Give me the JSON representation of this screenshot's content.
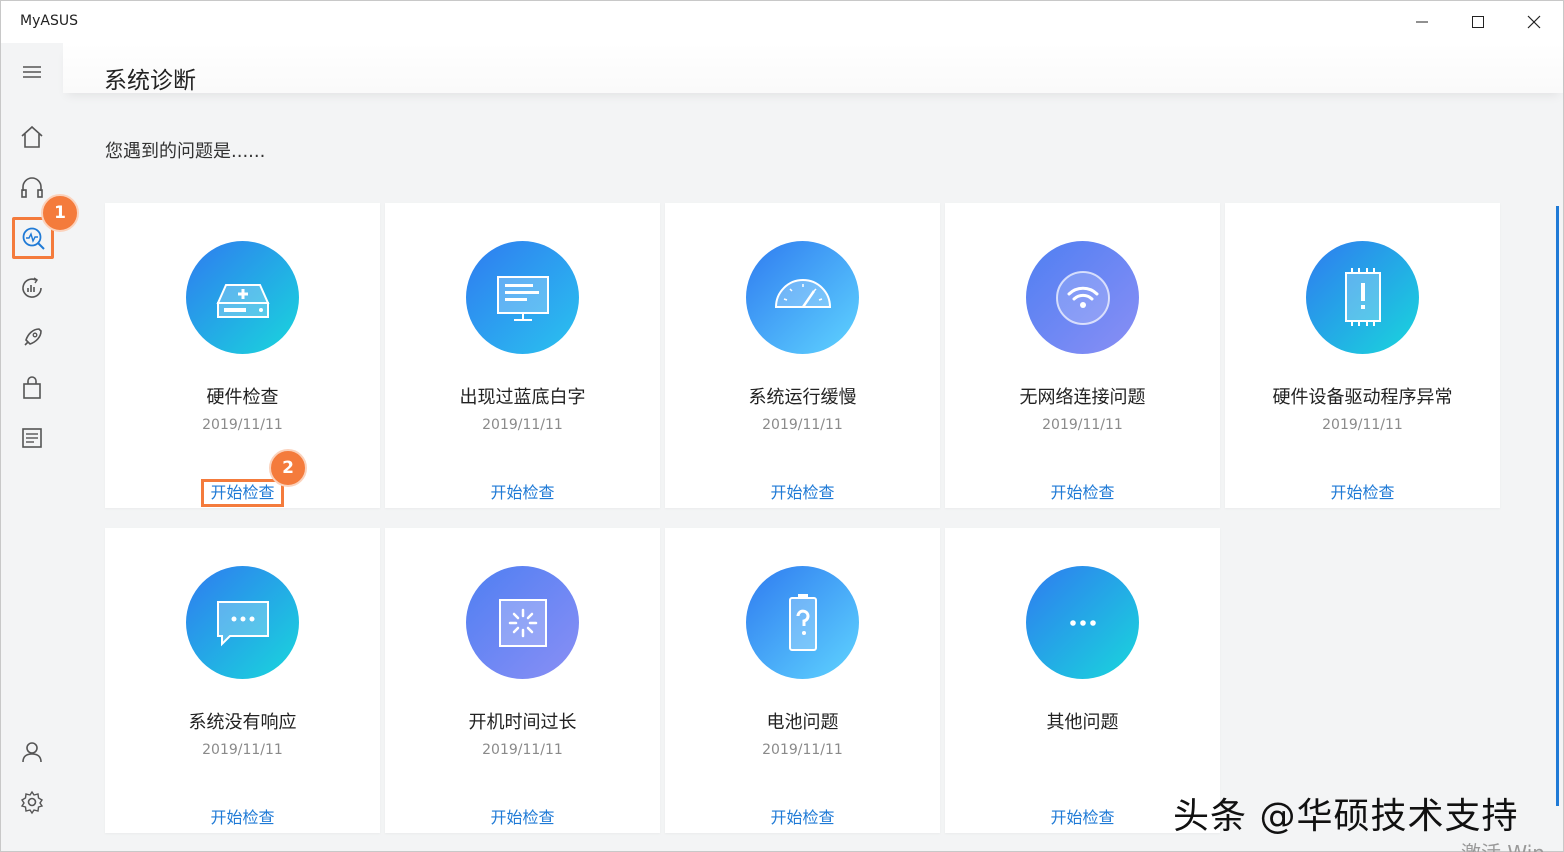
{
  "app": {
    "title": "MyASUS"
  },
  "header": {
    "title": "系统诊断"
  },
  "main": {
    "subtitle": "您遇到的问题是......"
  },
  "markers": {
    "one": "1",
    "two": "2"
  },
  "cards": [
    {
      "name": "硬件检查",
      "date": "2019/11/11",
      "action": "开始检查",
      "icon": "hard-drive-icon",
      "gradient": [
        "#2f7bf0",
        "#19d7dc"
      ]
    },
    {
      "name": "出现过蓝底白字",
      "date": "2019/11/11",
      "action": "开始检查",
      "icon": "monitor-icon",
      "gradient": [
        "#2f7bf0",
        "#2ac3ef"
      ]
    },
    {
      "name": "系统运行缓慢",
      "date": "2019/11/11",
      "action": "开始检查",
      "icon": "speedometer-icon",
      "gradient": [
        "#2f7bf0",
        "#5fd4ff"
      ]
    },
    {
      "name": "无网络连接问题",
      "date": "2019/11/11",
      "action": "开始检查",
      "icon": "wifi-icon",
      "gradient": [
        "#4f7ff2",
        "#8a8ff5"
      ]
    },
    {
      "name": "硬件设备驱动程序异常",
      "date": "2019/11/11",
      "action": "开始检查",
      "icon": "chip-alert-icon",
      "gradient": [
        "#2f7bf0",
        "#19d7dc"
      ]
    },
    {
      "name": "系统没有响应",
      "date": "2019/11/11",
      "action": "开始检查",
      "icon": "message-icon",
      "gradient": [
        "#2f7bf0",
        "#19d7dc"
      ]
    },
    {
      "name": "开机时间过长",
      "date": "2019/11/11",
      "action": "开始检查",
      "icon": "loading-icon",
      "gradient": [
        "#4f7ff2",
        "#8a8ff5"
      ]
    },
    {
      "name": "电池问题",
      "date": "2019/11/11",
      "action": "开始检查",
      "icon": "battery-question-icon",
      "gradient": [
        "#2f7bf0",
        "#5fd4ff"
      ]
    },
    {
      "name": "其他问题",
      "date": "",
      "action": "开始检查",
      "icon": "more-icon",
      "gradient": [
        "#2f7bf0",
        "#19d7dc"
      ]
    }
  ],
  "watermark": "头条 @华硕技术支持",
  "activation_text": "激活 Win",
  "colors": {
    "accent": "#1f7ad6",
    "marker": "#f47b3c"
  }
}
